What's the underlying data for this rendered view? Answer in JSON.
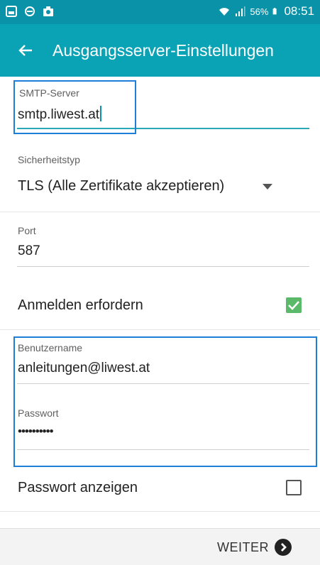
{
  "status_bar": {
    "battery": "56%",
    "time": "08:51",
    "icons": [
      "image-icon",
      "sync-icon",
      "camera-icon",
      "wifi-icon",
      "signal-icon",
      "battery-icon"
    ]
  },
  "app_bar": {
    "title": "Ausgangsserver-Einstellungen",
    "back_icon": "arrow-left-icon"
  },
  "smtp": {
    "label": "SMTP-Server",
    "value": "smtp.liwest.at"
  },
  "security": {
    "label": "Sicherheitstyp",
    "value": "TLS (Alle Zertifikate akzeptieren)"
  },
  "port": {
    "label": "Port",
    "value": "587"
  },
  "require_login": {
    "label": "Anmelden erfordern",
    "checked": true
  },
  "username": {
    "label": "Benutzername",
    "value": "anleitungen@liwest.at"
  },
  "password": {
    "label": "Passwort",
    "value": "••••••••••"
  },
  "show_password": {
    "label": "Passwort anzeigen",
    "checked": false
  },
  "footer": {
    "next_label": "WEITER"
  },
  "colors": {
    "status_bar": "#0a93a8",
    "app_bar": "#0aa3b6",
    "highlight": "#1e7fd8",
    "checkbox_checked": "#5bb96a"
  }
}
